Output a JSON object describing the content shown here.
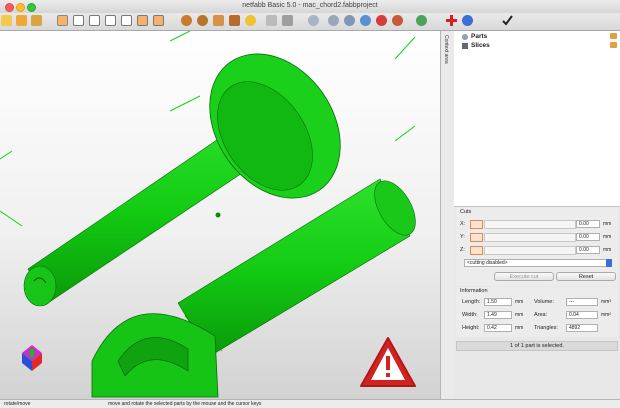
{
  "window": {
    "title": "netfabb Basic 5.0 - mac_chord2.fabbproject"
  },
  "context_strip": {
    "label": "Context area"
  },
  "tree": {
    "items": [
      {
        "label": "Parts"
      },
      {
        "label": "Slices"
      }
    ]
  },
  "cuts": {
    "title": "Cuts",
    "x_label": "X:",
    "y_label": "Y:",
    "z_label": "Z:",
    "x_value": "0.00",
    "y_value": "0.00",
    "z_value": "0.00",
    "unit": "mm",
    "dropdown": "<cutting disabled>",
    "execute_label": "Execute cut",
    "reset_label": "Reset"
  },
  "info": {
    "title": "Information",
    "length_label": "Length:",
    "length_value": "1.50",
    "width_label": "Width:",
    "width_value": "1.49",
    "height_label": "Height:",
    "height_value": "0.42",
    "unit_mm": "mm",
    "volume_label": "Volume:",
    "volume_value": "---",
    "volume_unit": "mm³",
    "area_label": "Area:",
    "area_value": "0.04",
    "area_unit": "mm²",
    "triangles_label": "Triangles:",
    "triangles_value": "4892"
  },
  "selection_status": "1 of 1 part is selected.",
  "statusbar": {
    "mode": "rotate/move",
    "hint": "move and rotate the selected parts by the mouse and the cursor keys"
  },
  "colors": {
    "part_green": "#1bd21b",
    "warning_red": "#d32222",
    "accent_blue": "#3a6fd8"
  }
}
